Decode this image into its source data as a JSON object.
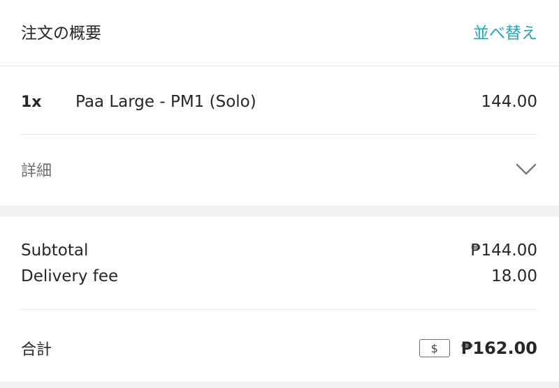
{
  "header": {
    "title": "注文の概要",
    "reorder_label": "並べ替え"
  },
  "items": [
    {
      "quantity": "1x",
      "name": "Paa Large - PM1 (Solo)",
      "price": "144.00"
    }
  ],
  "details": {
    "label": "詳細",
    "icon": "chevron-down-icon",
    "expanded": false
  },
  "summary": {
    "subtotal_label": "Subtotal",
    "subtotal_value": "₱144.00",
    "delivery_fee_label": "Delivery fee",
    "delivery_fee_value": "18.00",
    "total_label": "合計",
    "payment_icon": "cash-icon",
    "payment_symbol": "$",
    "total_value": "₱162.00"
  },
  "colors": {
    "accent": "#22a8b8",
    "muted_text": "#6f6f6f",
    "page_background": "#f2f2f3"
  }
}
